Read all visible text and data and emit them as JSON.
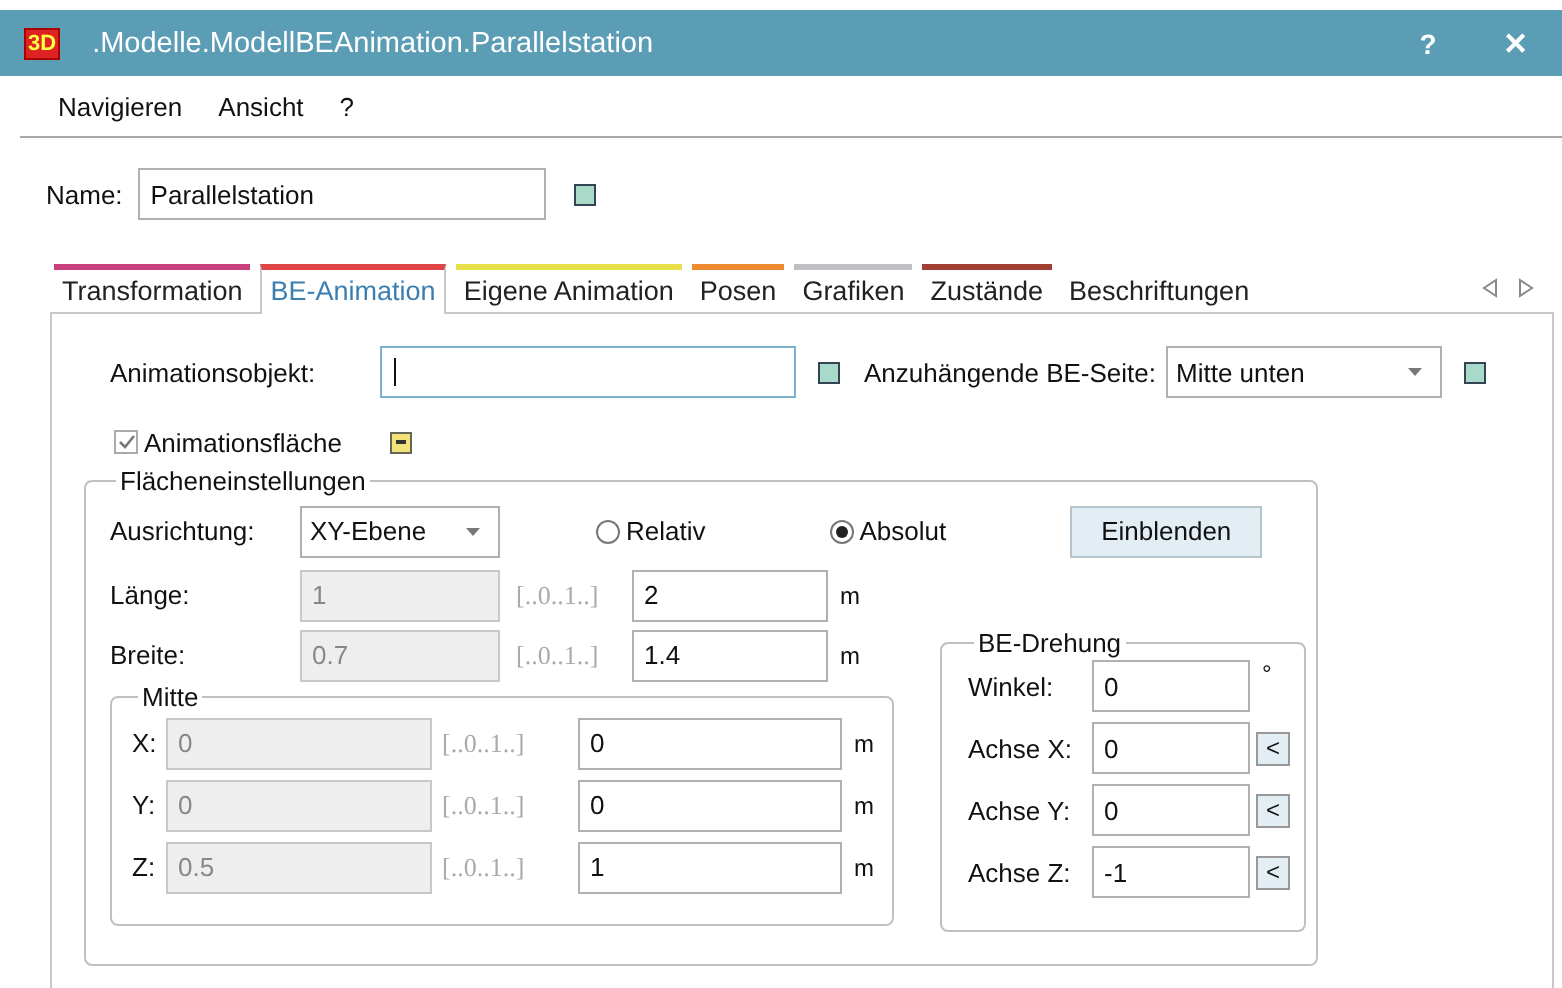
{
  "window": {
    "app_icon_text": "3D",
    "title": ".Modelle.ModellBEAnimation.Parallelstation",
    "help_button": "?",
    "close_button": "✕"
  },
  "menu": [
    {
      "label": "Navigieren"
    },
    {
      "label": "Ansicht"
    },
    {
      "label": "?"
    }
  ],
  "name": {
    "label": "Name:",
    "value": "Parallelstation",
    "marker_mixed": false
  },
  "tabs": [
    {
      "label": "Transformation",
      "color": "#c8407c",
      "selected": false
    },
    {
      "label": "BE-Animation",
      "color": "#e04444",
      "selected": true
    },
    {
      "label": "Eigene Animation",
      "color": "#e8e048",
      "selected": false
    },
    {
      "label": "Posen",
      "color": "#f08a30",
      "selected": false
    },
    {
      "label": "Grafiken",
      "color": "#c0c0c4",
      "selected": false
    },
    {
      "label": "Zustände",
      "color": "#a04034",
      "selected": false
    },
    {
      "label": "Beschriftungen",
      "selected": false
    }
  ],
  "animation_object": {
    "label": "Animationsobjekt:",
    "focused": true,
    "marker_mixed": false
  },
  "attach_side": {
    "label": "Anzuhängende BE-Seite:",
    "value": "Mitte unten",
    "marker_mixed": false
  },
  "animation_surface": {
    "label": "Animationsfläche",
    "checked": true,
    "disabled": true,
    "marker_mixed": true
  },
  "surface_settings": {
    "title": "Flächeneinstellungen",
    "orientation": {
      "label": "Ausrichtung:",
      "value": "XY-Ebene"
    },
    "modes": [
      {
        "label": "Relativ",
        "selected": false
      },
      {
        "label": "Absolut",
        "selected": true
      }
    ],
    "show_button": "Einblenden",
    "rows": [
      {
        "label": "Länge:",
        "relative": "1",
        "range": "[..0..1..]",
        "absolute": "2",
        "unit": "m"
      },
      {
        "label": "Breite:",
        "relative": "0.7",
        "range": "[..0..1..]",
        "absolute": "1.4",
        "unit": "m"
      }
    ],
    "center": {
      "title": "Mitte",
      "rows": [
        {
          "label": "X:",
          "relative": "0",
          "range": "[..0..1..]",
          "absolute": "0",
          "unit": "m"
        },
        {
          "label": "Y:",
          "relative": "0",
          "range": "[..0..1..]",
          "absolute": "0",
          "unit": "m"
        },
        {
          "label": "Z:",
          "relative": "0.5",
          "range": "[..0..1..]",
          "absolute": "1",
          "unit": "m"
        }
      ]
    },
    "rotation": {
      "title": "BE-Drehung",
      "rows": [
        {
          "label": "Winkel:",
          "value": "0",
          "unit": "°"
        },
        {
          "label": "Achse X:",
          "value": "0",
          "button": "<"
        },
        {
          "label": "Achse Y:",
          "value": "0",
          "button": "<"
        },
        {
          "label": "Achse Z:",
          "value": "-1",
          "button": "<"
        }
      ]
    }
  }
}
